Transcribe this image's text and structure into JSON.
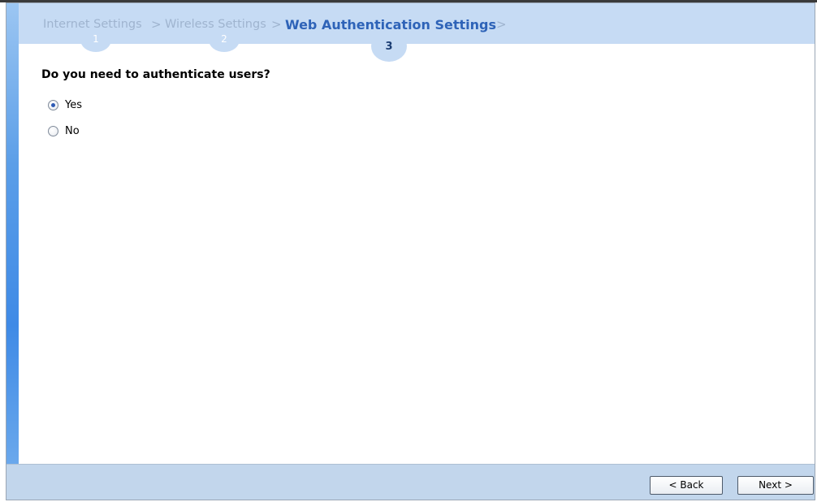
{
  "wizard": {
    "steps": [
      {
        "label": "Internet Settings",
        "number": "1"
      },
      {
        "label": "Wireless Settings",
        "number": "2"
      },
      {
        "label": "Web Authentication Settings",
        "number": "3"
      }
    ],
    "separator": ">",
    "active_step": 3
  },
  "main": {
    "question": "Do you need to authenticate users?",
    "options": [
      {
        "label": "Yes",
        "selected": true
      },
      {
        "label": "No",
        "selected": false
      }
    ]
  },
  "footer": {
    "back_label": "< Back",
    "next_label": "Next >"
  },
  "colors": {
    "header_bg": "#c6dbf4",
    "active_step": "#2e63b8",
    "inactive_step": "#9fb4cf",
    "footer_bg": "#c2d6ec",
    "side_accent": "#3f8ae6"
  }
}
